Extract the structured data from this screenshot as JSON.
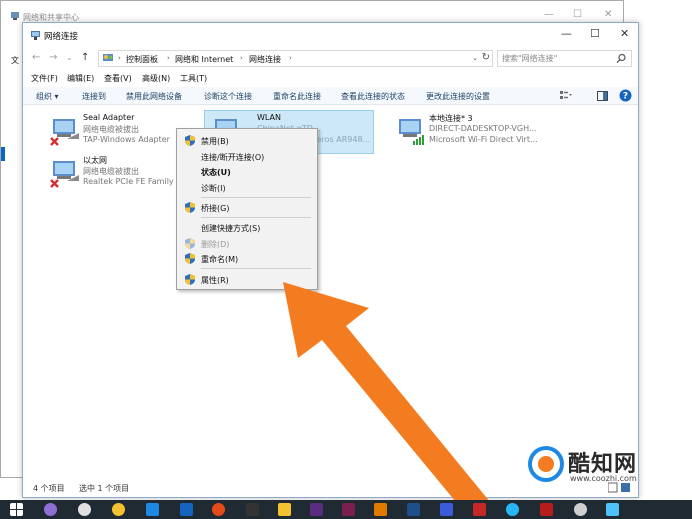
{
  "background_window": {
    "title": "网络和共享中心",
    "file_menu_fragment": "文",
    "controls": [
      "—",
      "☐",
      "✕"
    ]
  },
  "window": {
    "title": "网络连接",
    "controls": [
      "—",
      "☐",
      "✕"
    ]
  },
  "nav": {
    "back": "←",
    "forward": "→",
    "recent": "⌄",
    "up": "↑"
  },
  "address": {
    "crumbs": [
      "控制面板",
      "网络和 Internet",
      "网络连接"
    ],
    "separator": "›",
    "dropdown": "⌄",
    "refresh": "↻"
  },
  "search": {
    "placeholder": "搜索\"网络连接\""
  },
  "menubar": {
    "items": [
      "文件(F)",
      "编辑(E)",
      "查看(V)",
      "高级(N)",
      "工具(T)"
    ]
  },
  "commandbar": {
    "organize": "组织 ▾",
    "items": [
      "连接到",
      "禁用此网络设备",
      "诊断这个连接",
      "重命名此连接",
      "查看此连接的状态",
      "更改此连接的设置"
    ]
  },
  "adapters": [
    {
      "name": "Seal Adapter",
      "status": "网络电缆被拔出",
      "device": "TAP-Windows Adapter",
      "icon": "ethernet-disconnected-icon",
      "selected": false
    },
    {
      "name": "WLAN",
      "status": "ChinaNet-pTD...",
      "device": "...eros AR948...",
      "icon": "wifi-adapter-icon",
      "selected": true
    },
    {
      "name": "本地连接* 3",
      "status": "DIRECT-DADESKTOP-VGH...",
      "device": "Microsoft Wi-Fi Direct Virt...",
      "icon": "wifi-direct-icon",
      "selected": false
    },
    {
      "name": "以太网",
      "status": "网络电缆被拔出",
      "device": "Realtek PCIe FE Family",
      "icon": "ethernet-disconnected-icon",
      "selected": false
    }
  ],
  "status_bar": {
    "item_count": "4 个项目",
    "selected_count": "选中 1 个项目"
  },
  "context_menu": {
    "items": [
      {
        "label": "禁用(B)",
        "shield": true,
        "bold": false,
        "disabled": false
      },
      {
        "label": "连接/断开连接(O)",
        "shield": false,
        "bold": false,
        "disabled": false
      },
      {
        "label": "状态(U)",
        "shield": false,
        "bold": true,
        "disabled": false
      },
      {
        "label": "诊断(I)",
        "shield": false,
        "bold": false,
        "disabled": false
      },
      {
        "label": "桥接(G)",
        "shield": true,
        "bold": false,
        "disabled": false
      },
      {
        "label": "创建快捷方式(S)",
        "shield": false,
        "bold": false,
        "disabled": false
      },
      {
        "label": "删除(D)",
        "shield": true,
        "bold": false,
        "disabled": true
      },
      {
        "label": "重命名(M)",
        "shield": true,
        "bold": false,
        "disabled": false
      },
      {
        "label": "属性(R)",
        "shield": true,
        "bold": false,
        "disabled": false
      }
    ]
  },
  "watermark": {
    "text": "酷知网",
    "url": "www.coozhi.com"
  },
  "colors": {
    "accent": "#0a66c2",
    "selection": "#cde8f7",
    "arrow": "#f47c20",
    "taskbar": "#1f2a33"
  }
}
